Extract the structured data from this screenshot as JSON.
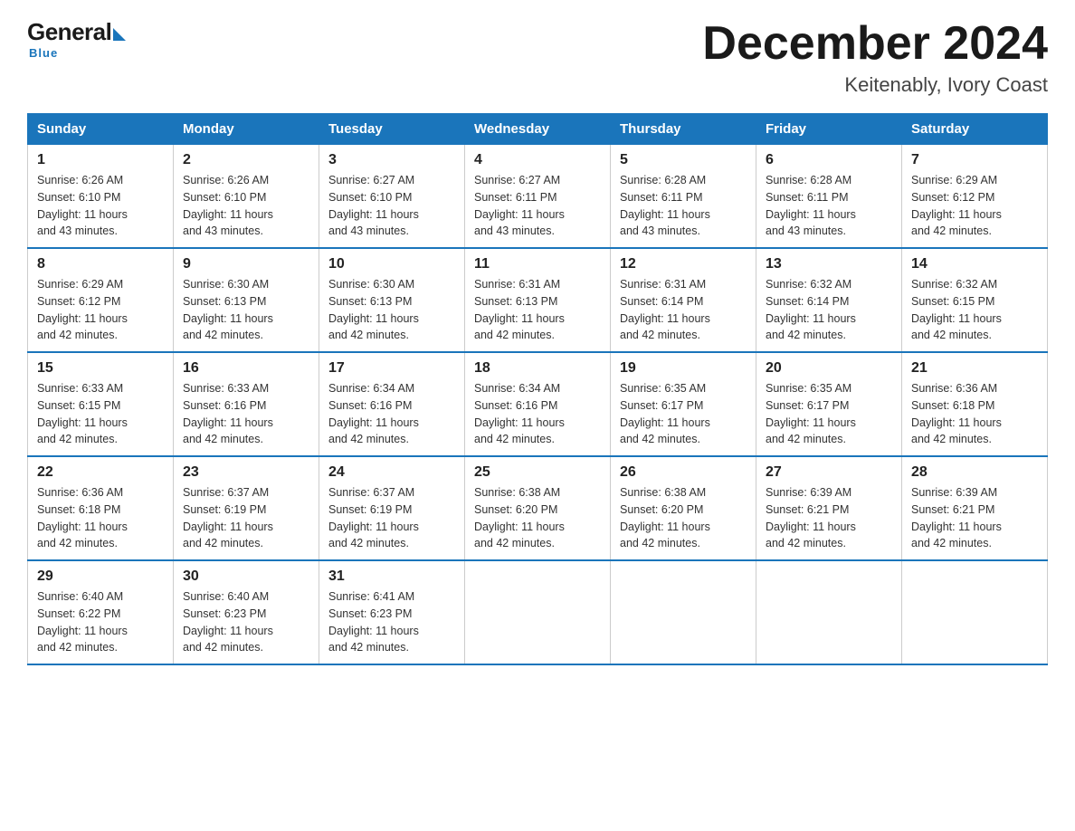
{
  "logo": {
    "general": "General",
    "blue": "Blue",
    "sub": "Blue"
  },
  "header": {
    "month_title": "December 2024",
    "location": "Keitenably, Ivory Coast"
  },
  "weekdays": [
    "Sunday",
    "Monday",
    "Tuesday",
    "Wednesday",
    "Thursday",
    "Friday",
    "Saturday"
  ],
  "weeks": [
    [
      {
        "day": "1",
        "sunrise": "6:26 AM",
        "sunset": "6:10 PM",
        "daylight": "11 hours and 43 minutes."
      },
      {
        "day": "2",
        "sunrise": "6:26 AM",
        "sunset": "6:10 PM",
        "daylight": "11 hours and 43 minutes."
      },
      {
        "day": "3",
        "sunrise": "6:27 AM",
        "sunset": "6:10 PM",
        "daylight": "11 hours and 43 minutes."
      },
      {
        "day": "4",
        "sunrise": "6:27 AM",
        "sunset": "6:11 PM",
        "daylight": "11 hours and 43 minutes."
      },
      {
        "day": "5",
        "sunrise": "6:28 AM",
        "sunset": "6:11 PM",
        "daylight": "11 hours and 43 minutes."
      },
      {
        "day": "6",
        "sunrise": "6:28 AM",
        "sunset": "6:11 PM",
        "daylight": "11 hours and 43 minutes."
      },
      {
        "day": "7",
        "sunrise": "6:29 AM",
        "sunset": "6:12 PM",
        "daylight": "11 hours and 42 minutes."
      }
    ],
    [
      {
        "day": "8",
        "sunrise": "6:29 AM",
        "sunset": "6:12 PM",
        "daylight": "11 hours and 42 minutes."
      },
      {
        "day": "9",
        "sunrise": "6:30 AM",
        "sunset": "6:13 PM",
        "daylight": "11 hours and 42 minutes."
      },
      {
        "day": "10",
        "sunrise": "6:30 AM",
        "sunset": "6:13 PM",
        "daylight": "11 hours and 42 minutes."
      },
      {
        "day": "11",
        "sunrise": "6:31 AM",
        "sunset": "6:13 PM",
        "daylight": "11 hours and 42 minutes."
      },
      {
        "day": "12",
        "sunrise": "6:31 AM",
        "sunset": "6:14 PM",
        "daylight": "11 hours and 42 minutes."
      },
      {
        "day": "13",
        "sunrise": "6:32 AM",
        "sunset": "6:14 PM",
        "daylight": "11 hours and 42 minutes."
      },
      {
        "day": "14",
        "sunrise": "6:32 AM",
        "sunset": "6:15 PM",
        "daylight": "11 hours and 42 minutes."
      }
    ],
    [
      {
        "day": "15",
        "sunrise": "6:33 AM",
        "sunset": "6:15 PM",
        "daylight": "11 hours and 42 minutes."
      },
      {
        "day": "16",
        "sunrise": "6:33 AM",
        "sunset": "6:16 PM",
        "daylight": "11 hours and 42 minutes."
      },
      {
        "day": "17",
        "sunrise": "6:34 AM",
        "sunset": "6:16 PM",
        "daylight": "11 hours and 42 minutes."
      },
      {
        "day": "18",
        "sunrise": "6:34 AM",
        "sunset": "6:16 PM",
        "daylight": "11 hours and 42 minutes."
      },
      {
        "day": "19",
        "sunrise": "6:35 AM",
        "sunset": "6:17 PM",
        "daylight": "11 hours and 42 minutes."
      },
      {
        "day": "20",
        "sunrise": "6:35 AM",
        "sunset": "6:17 PM",
        "daylight": "11 hours and 42 minutes."
      },
      {
        "day": "21",
        "sunrise": "6:36 AM",
        "sunset": "6:18 PM",
        "daylight": "11 hours and 42 minutes."
      }
    ],
    [
      {
        "day": "22",
        "sunrise": "6:36 AM",
        "sunset": "6:18 PM",
        "daylight": "11 hours and 42 minutes."
      },
      {
        "day": "23",
        "sunrise": "6:37 AM",
        "sunset": "6:19 PM",
        "daylight": "11 hours and 42 minutes."
      },
      {
        "day": "24",
        "sunrise": "6:37 AM",
        "sunset": "6:19 PM",
        "daylight": "11 hours and 42 minutes."
      },
      {
        "day": "25",
        "sunrise": "6:38 AM",
        "sunset": "6:20 PM",
        "daylight": "11 hours and 42 minutes."
      },
      {
        "day": "26",
        "sunrise": "6:38 AM",
        "sunset": "6:20 PM",
        "daylight": "11 hours and 42 minutes."
      },
      {
        "day": "27",
        "sunrise": "6:39 AM",
        "sunset": "6:21 PM",
        "daylight": "11 hours and 42 minutes."
      },
      {
        "day": "28",
        "sunrise": "6:39 AM",
        "sunset": "6:21 PM",
        "daylight": "11 hours and 42 minutes."
      }
    ],
    [
      {
        "day": "29",
        "sunrise": "6:40 AM",
        "sunset": "6:22 PM",
        "daylight": "11 hours and 42 minutes."
      },
      {
        "day": "30",
        "sunrise": "6:40 AM",
        "sunset": "6:23 PM",
        "daylight": "11 hours and 42 minutes."
      },
      {
        "day": "31",
        "sunrise": "6:41 AM",
        "sunset": "6:23 PM",
        "daylight": "11 hours and 42 minutes."
      },
      null,
      null,
      null,
      null
    ]
  ],
  "labels": {
    "sunrise": "Sunrise:",
    "sunset": "Sunset:",
    "daylight": "Daylight:"
  }
}
